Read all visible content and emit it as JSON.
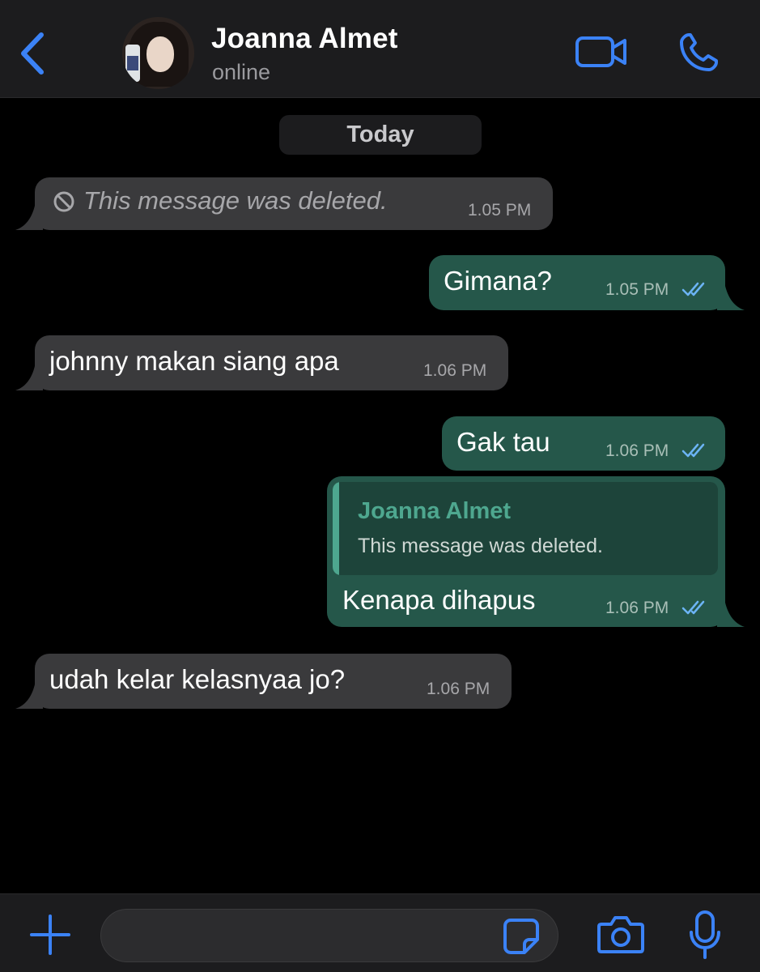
{
  "header": {
    "contact_name": "Joanna Almet",
    "status": "online"
  },
  "date_separator": "Today",
  "messages": [
    {
      "direction": "incoming",
      "deleted": true,
      "text": "This message was deleted.",
      "time": "1.05 PM"
    },
    {
      "direction": "outgoing",
      "text": "Gimana?",
      "time": "1.05 PM",
      "read": true
    },
    {
      "direction": "incoming",
      "text": "johnny makan siang apa",
      "time": "1.06 PM"
    },
    {
      "direction": "outgoing",
      "text": "Gak tau",
      "time": "1.06 PM",
      "read": true
    },
    {
      "direction": "outgoing",
      "reply_to": {
        "name": "Joanna Almet",
        "text": "This message was deleted."
      },
      "text": "Kenapa dihapus",
      "time": "1.06 PM",
      "read": true
    },
    {
      "direction": "incoming",
      "text": "udah kelar kelasnyaa jo?",
      "time": "1.06 PM"
    }
  ],
  "composer": {
    "placeholder": ""
  },
  "icons": {
    "back": "chevron-left-icon",
    "video": "video-camera-icon",
    "call": "phone-icon",
    "deleted": "prohibited-icon",
    "read_ticks": "double-check-icon",
    "attach": "plus-icon",
    "sticker": "sticker-icon",
    "camera": "camera-icon",
    "mic": "microphone-icon"
  },
  "colors": {
    "accent": "#3b82f6",
    "incoming_bubble": "#3a3a3c",
    "outgoing_bubble": "#25574a",
    "quote_accent": "#4ea78f",
    "background": "#000000"
  }
}
